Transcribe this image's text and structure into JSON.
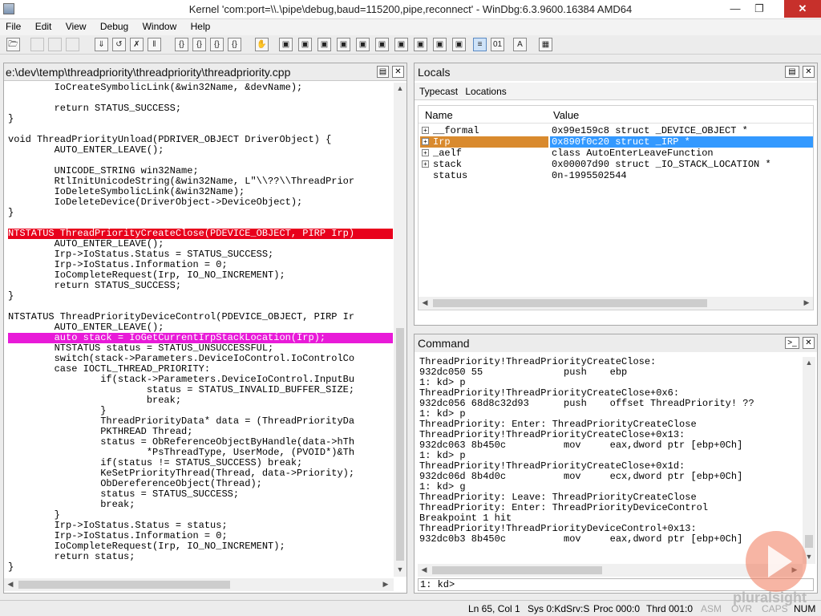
{
  "window": {
    "title": "Kernel 'com:port=\\\\.\\pipe\\debug,baud=115200,pipe,reconnect' - WinDbg:6.3.9600.16384 AMD64"
  },
  "menu": [
    "File",
    "Edit",
    "View",
    "Debug",
    "Window",
    "Help"
  ],
  "source": {
    "path": "e:\\dev\\temp\\threadpriority\\threadpriority\\threadpriority.cpp",
    "lines": [
      "        IoCreateSymbolicLink(&win32Name, &devName);",
      "",
      "        return STATUS_SUCCESS;",
      "}",
      "",
      "void ThreadPriorityUnload(PDRIVER_OBJECT DriverObject) {",
      "        AUTO_ENTER_LEAVE();",
      "",
      "        UNICODE_STRING win32Name;",
      "        RtlInitUnicodeString(&win32Name, L\"\\\\??\\\\ThreadPrior",
      "        IoDeleteSymbolicLink(&win32Name);",
      "        IoDeleteDevice(DriverObject->DeviceObject);",
      "}",
      "",
      "NTSTATUS ThreadPriorityCreateClose(PDEVICE_OBJECT, PIRP Irp)",
      "        AUTO_ENTER_LEAVE();",
      "        Irp->IoStatus.Status = STATUS_SUCCESS;",
      "        Irp->IoStatus.Information = 0;",
      "        IoCompleteRequest(Irp, IO_NO_INCREMENT);",
      "        return STATUS_SUCCESS;",
      "}",
      "",
      "NTSTATUS ThreadPriorityDeviceControl(PDEVICE_OBJECT, PIRP Ir",
      "        AUTO_ENTER_LEAVE();",
      "        auto stack = IoGetCurrentIrpStackLocation(Irp);",
      "        NTSTATUS status = STATUS_UNSUCCESSFUL;",
      "        switch(stack->Parameters.DeviceIoControl.IoControlCo",
      "        case IOCTL_THREAD_PRIORITY:",
      "                if(stack->Parameters.DeviceIoControl.InputBu",
      "                        status = STATUS_INVALID_BUFFER_SIZE;",
      "                        break;",
      "                }",
      "                ThreadPriorityData* data = (ThreadPriorityDa",
      "                PKTHREAD Thread;",
      "                status = ObReferenceObjectByHandle(data->hTh",
      "                        *PsThreadType, UserMode, (PVOID*)&Th",
      "                if(status != STATUS_SUCCESS) break;",
      "                KeSetPriorityThread(Thread, data->Priority);",
      "                ObDereferenceObject(Thread);",
      "                status = STATUS_SUCCESS;",
      "                break;",
      "        }",
      "        Irp->IoStatus.Status = status;",
      "        Irp->IoStatus.Information = 0;",
      "        IoCompleteRequest(Irp, IO_NO_INCREMENT);",
      "        return status;",
      "}"
    ],
    "highlight_red_line": 14,
    "highlight_magenta_line": 24
  },
  "locals": {
    "title": "Locals",
    "tabs": [
      "Typecast",
      "Locations"
    ],
    "columns": [
      "Name",
      "Value"
    ],
    "rows": [
      {
        "expand": "+",
        "name": "__formal",
        "value": "0x99e159c8 struct _DEVICE_OBJECT *"
      },
      {
        "expand": "+",
        "name": "Irp",
        "value": "0x890f0c20 struct _IRP *"
      },
      {
        "expand": "+",
        "name": "_aelf",
        "value": "class AutoEnterLeaveFunction"
      },
      {
        "expand": "+",
        "name": "stack",
        "value": "0x00007d90 struct _IO_STACK_LOCATION *"
      },
      {
        "expand": "",
        "name": "status",
        "value": "0n-1995502544"
      }
    ],
    "selected_row": 1
  },
  "command": {
    "title": "Command",
    "output": [
      "ThreadPriority!ThreadPriorityCreateClose:",
      "932dc050 55              push    ebp",
      "1: kd> p",
      "ThreadPriority!ThreadPriorityCreateClose+0x6:",
      "932dc056 68d8c32d93      push    offset ThreadPriority! ??",
      "1: kd> p",
      "ThreadPriority: Enter: ThreadPriorityCreateClose",
      "ThreadPriority!ThreadPriorityCreateClose+0x13:",
      "932dc063 8b450c          mov     eax,dword ptr [ebp+0Ch]",
      "1: kd> p",
      "ThreadPriority!ThreadPriorityCreateClose+0x1d:",
      "932dc06d 8b4d0c          mov     ecx,dword ptr [ebp+0Ch]",
      "1: kd> g",
      "ThreadPriority: Leave: ThreadPriorityCreateClose",
      "ThreadPriority: Enter: ThreadPriorityDeviceControl",
      "Breakpoint 1 hit",
      "ThreadPriority!ThreadPriorityDeviceControl+0x13:",
      "932dc0b3 8b450c          mov     eax,dword ptr [ebp+0Ch]"
    ],
    "prompt": "1: kd>"
  },
  "status": {
    "position": "Ln 65, Col 1",
    "sys": "Sys 0:KdSrv:S",
    "proc": "Proc 000:0",
    "thrd": "Thrd 001:0",
    "asm": "ASM",
    "ovr": "OVR",
    "caps": "CAPS",
    "num": "NUM"
  },
  "watermark": "pluralsight"
}
